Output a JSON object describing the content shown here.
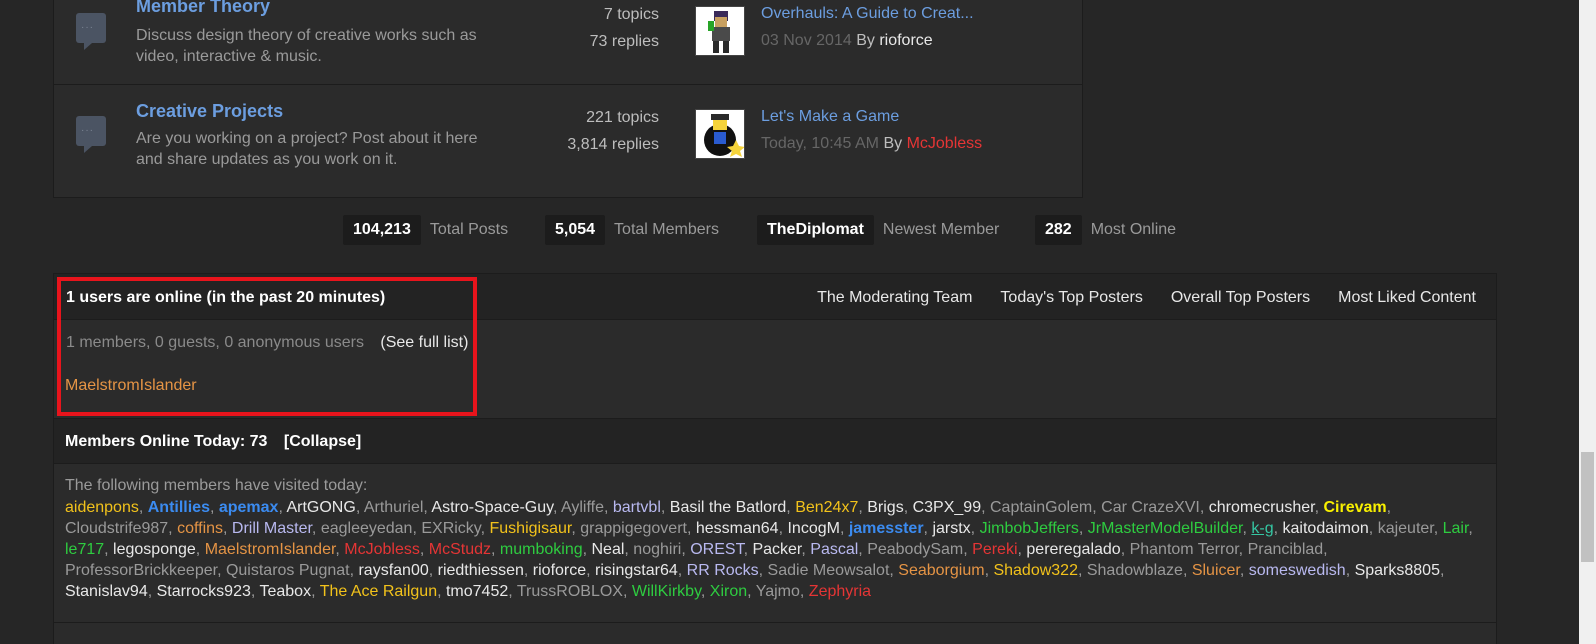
{
  "forums": [
    {
      "title": "Member Theory",
      "description": "Discuss design theory of creative works such as video, interactive & music.",
      "topics": "7 topics",
      "replies": "73 replies",
      "last_post_title": "Overhauls: A Guide to Creat...",
      "last_post_date": "03 Nov 2014",
      "by_label": "By",
      "last_post_author": "rioforce"
    },
    {
      "title": "Creative Projects",
      "description": "Are you working on a project? Post about it here and share updates as you work on it.",
      "topics": "221 topics",
      "replies": "3,814 replies",
      "last_post_title": "Let's Make a Game",
      "last_post_date": "Today, 10:45 AM",
      "by_label": "By",
      "last_post_author": "McJobless"
    }
  ],
  "stats": [
    {
      "value": "104,213",
      "label": "Total Posts"
    },
    {
      "value": "5,054",
      "label": "Total Members"
    },
    {
      "value": "TheDiplomat",
      "label": "Newest Member"
    },
    {
      "value": "282",
      "label": "Most Online"
    }
  ],
  "online": {
    "title": "1 users are online (in the past 20 minutes)",
    "links": [
      "The Moderating Team",
      "Today's Top Posters",
      "Overall Top Posters",
      "Most Liked Content"
    ],
    "members_count": "1 members,",
    "guests_count": "0 guests,",
    "anonymous_count": "0 anonymous users",
    "see_full": "(See full list)",
    "online_user": "MaelstromIslander",
    "online_user_color": "#e59445"
  },
  "today": {
    "title": "Members Online Today: 73",
    "collapse": "[Collapse]",
    "intro": "The following members have visited today:"
  },
  "members": [
    {
      "name": "aidenpons",
      "color": "#f2c21b"
    },
    {
      "name": "Antillies",
      "color": "#3b8bf0",
      "bold": true
    },
    {
      "name": "apemax",
      "color": "#3b8bf0",
      "bold": true
    },
    {
      "name": "ArtGONG",
      "color": "#e8e8e8"
    },
    {
      "name": "Arthuriel",
      "color": "#9a9a9a"
    },
    {
      "name": "Astro-Space-Guy",
      "color": "#e8e8e8"
    },
    {
      "name": "Ayliffe",
      "color": "#9a9a9a"
    },
    {
      "name": "bartvbl",
      "color": "#b9b9f0"
    },
    {
      "name": "Basil the Batlord",
      "color": "#e8e8e8"
    },
    {
      "name": "Ben24x7",
      "color": "#f2c21b"
    },
    {
      "name": "Brigs",
      "color": "#e8e8e8"
    },
    {
      "name": "C3PX_99",
      "color": "#e8e8e8"
    },
    {
      "name": "CaptainGolem",
      "color": "#9a9a9a"
    },
    {
      "name": "Car CrazeXVI",
      "color": "#9a9a9a"
    },
    {
      "name": "chromecrusher",
      "color": "#e8e8e8"
    },
    {
      "name": "Cirevam",
      "color": "#f8f000",
      "bold": true
    },
    {
      "name": "Cloudstrife987",
      "color": "#9a9a9a"
    },
    {
      "name": "coffins",
      "color": "#e59445"
    },
    {
      "name": "Drill Master",
      "color": "#b9b9f0"
    },
    {
      "name": "eagleeyedan",
      "color": "#9a9a9a"
    },
    {
      "name": "EXRicky",
      "color": "#9a9a9a"
    },
    {
      "name": "Fushigisaur",
      "color": "#f2c21b"
    },
    {
      "name": "grappigegovert",
      "color": "#9a9a9a"
    },
    {
      "name": "hessman64",
      "color": "#e8e8e8"
    },
    {
      "name": "IncogM",
      "color": "#e8e8e8"
    },
    {
      "name": "jamesster",
      "color": "#3b8bf0",
      "bold": true
    },
    {
      "name": "jarstx",
      "color": "#e8e8e8"
    },
    {
      "name": "JimbobJeffers",
      "color": "#2ecc40"
    },
    {
      "name": "JrMasterModelBuilder",
      "color": "#2ecc40"
    },
    {
      "name": "k-g",
      "color": "#35c7a3",
      "underline": true
    },
    {
      "name": "kaitodaimon",
      "color": "#e8e8e8"
    },
    {
      "name": "kajeuter",
      "color": "#9a9a9a"
    },
    {
      "name": "Lair",
      "color": "#2ecc40"
    },
    {
      "name": "le717",
      "color": "#2ecc40"
    },
    {
      "name": "legosponge",
      "color": "#e8e8e8"
    },
    {
      "name": "MaelstromIslander",
      "color": "#e59445"
    },
    {
      "name": "McJobless",
      "color": "#e53535"
    },
    {
      "name": "McStudz",
      "color": "#e53535"
    },
    {
      "name": "mumboking",
      "color": "#2ecc40"
    },
    {
      "name": "Neal",
      "color": "#e8e8e8"
    },
    {
      "name": "noghiri",
      "color": "#9a9a9a"
    },
    {
      "name": "OREST",
      "color": "#b9b9f0"
    },
    {
      "name": "Packer",
      "color": "#e8e8e8"
    },
    {
      "name": "Pascal",
      "color": "#b9b9f0"
    },
    {
      "name": "PeabodySam",
      "color": "#9a9a9a"
    },
    {
      "name": "Pereki",
      "color": "#e53535"
    },
    {
      "name": "pereregalado",
      "color": "#e8e8e8"
    },
    {
      "name": "Phantom Terror",
      "color": "#9a9a9a"
    },
    {
      "name": "Pranciblad",
      "color": "#9a9a9a"
    },
    {
      "name": "ProfessorBrickkeeper",
      "color": "#9a9a9a"
    },
    {
      "name": "Quistaros Pugnat",
      "color": "#9a9a9a"
    },
    {
      "name": "raysfan00",
      "color": "#e8e8e8"
    },
    {
      "name": "riedthiessen",
      "color": "#e8e8e8"
    },
    {
      "name": "rioforce",
      "color": "#e8e8e8"
    },
    {
      "name": "risingstar64",
      "color": "#e8e8e8"
    },
    {
      "name": "RR Rocks",
      "color": "#b9b9f0"
    },
    {
      "name": "Sadie Meowsalot",
      "color": "#9a9a9a"
    },
    {
      "name": "Seaborgium",
      "color": "#e59445"
    },
    {
      "name": "Shadow322",
      "color": "#f2c21b"
    },
    {
      "name": "Shadowblaze",
      "color": "#9a9a9a"
    },
    {
      "name": "Sluicer",
      "color": "#e59445"
    },
    {
      "name": "someswedish",
      "color": "#b9b9f0"
    },
    {
      "name": "Sparks8805",
      "color": "#e8e8e8"
    },
    {
      "name": "Stanislav94",
      "color": "#e8e8e8"
    },
    {
      "name": "Starrocks923",
      "color": "#e8e8e8"
    },
    {
      "name": "Teabox",
      "color": "#e8e8e8"
    },
    {
      "name": "The Ace Railgun",
      "color": "#f2c21b"
    },
    {
      "name": "tmo7452",
      "color": "#e8e8e8"
    },
    {
      "name": "TrussROBLOX",
      "color": "#9a9a9a"
    },
    {
      "name": "WillKirkby",
      "color": "#2ecc40"
    },
    {
      "name": "Xiron",
      "color": "#2ecc40"
    },
    {
      "name": "Yajmo",
      "color": "#9a9a9a"
    },
    {
      "name": "Zephyria",
      "color": "#e53535"
    }
  ],
  "colors": {
    "link_blue": "#6c9ee0",
    "highlight_box": "#e8141c",
    "background": "#262626"
  }
}
